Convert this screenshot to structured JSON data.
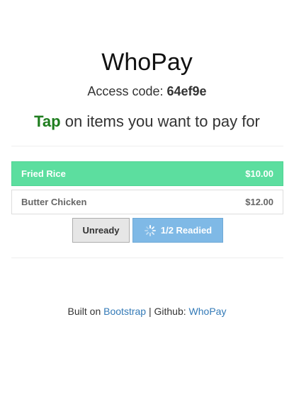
{
  "app": {
    "title": "WhoPay",
    "access_label": "Access code:",
    "access_code": "64ef9e",
    "instruction_tap": "Tap",
    "instruction_rest": "on items you want to pay for"
  },
  "items": [
    {
      "name": "Fried Rice",
      "price": "$10.00",
      "selected": true
    },
    {
      "name": "Butter Chicken",
      "price": "$12.00",
      "selected": false
    }
  ],
  "buttons": {
    "unready_label": "Unready",
    "readied_label": "1/2 Readied"
  },
  "footer": {
    "built_on": "Built on",
    "bootstrap_link": "Bootstrap",
    "separator": "| Github:",
    "github_link": "WhoPay"
  },
  "icons": {
    "spinner": "loading-spinner-icon"
  },
  "colors": {
    "selected_item": "#5cde9f",
    "readied_button": "#7fb9e6",
    "tap_accent": "#1e7d1e",
    "link": "#337ab7"
  }
}
